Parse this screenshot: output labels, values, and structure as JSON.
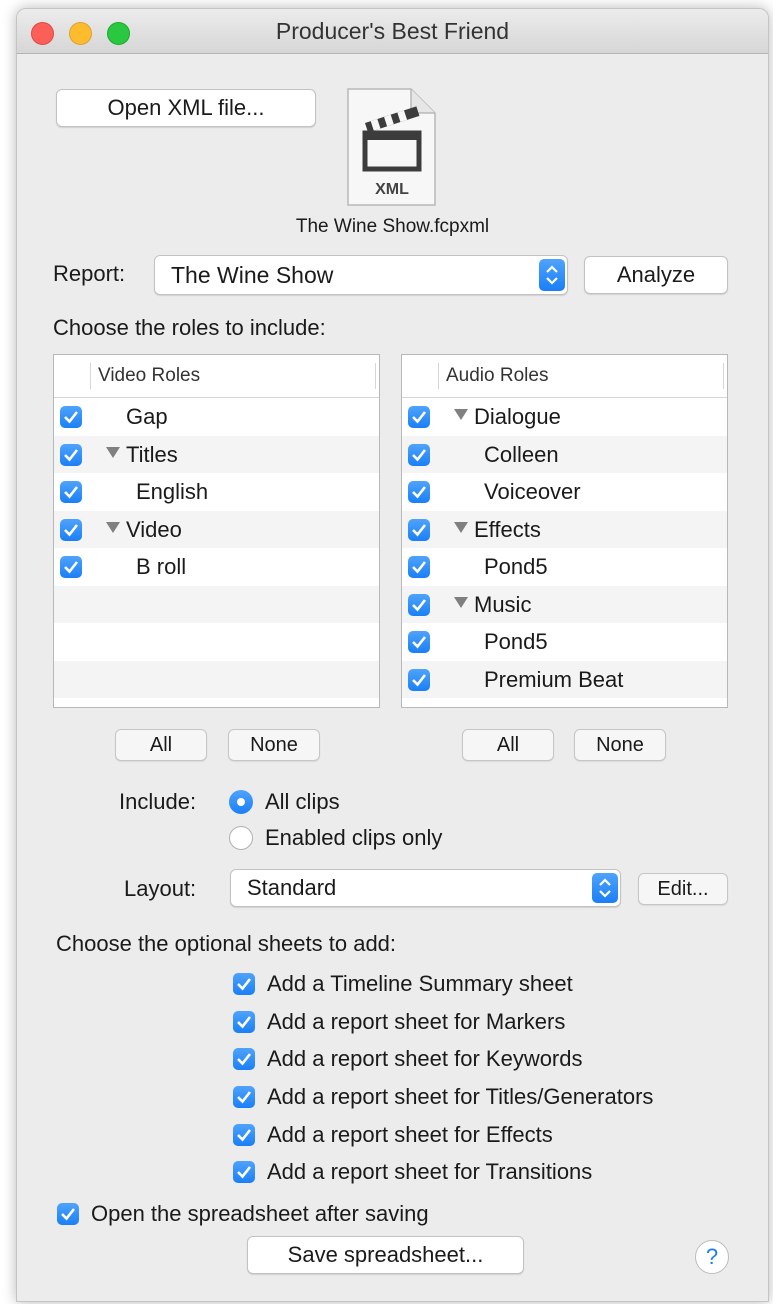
{
  "window": {
    "title": "Producer's Best Friend"
  },
  "file": {
    "open_button": "Open XML file...",
    "icon_badge": "XML",
    "filename": "The Wine Show.fcpxml"
  },
  "report": {
    "label": "Report:",
    "selected": "The Wine Show",
    "analyze_button": "Analyze"
  },
  "roles": {
    "heading": "Choose the roles to include:",
    "video": {
      "header": "Video Roles",
      "items": [
        {
          "label": "Gap",
          "checked": true
        },
        {
          "label": "Titles",
          "checked": true
        },
        {
          "label": "English",
          "checked": true
        },
        {
          "label": "Video",
          "checked": true
        },
        {
          "label": "B roll",
          "checked": true
        }
      ],
      "all_button": "All",
      "none_button": "None"
    },
    "audio": {
      "header": "Audio Roles",
      "items": [
        {
          "label": "Dialogue",
          "checked": true
        },
        {
          "label": "Colleen",
          "checked": true
        },
        {
          "label": "Voiceover",
          "checked": true
        },
        {
          "label": "Effects",
          "checked": true
        },
        {
          "label": "Pond5",
          "checked": true
        },
        {
          "label": "Music",
          "checked": true
        },
        {
          "label": "Pond5",
          "checked": true
        },
        {
          "label": "Premium Beat",
          "checked": true
        }
      ],
      "all_button": "All",
      "none_button": "None"
    }
  },
  "include": {
    "label": "Include:",
    "options": [
      {
        "label": "All clips",
        "selected": true
      },
      {
        "label": "Enabled clips only",
        "selected": false
      }
    ]
  },
  "layout": {
    "label": "Layout:",
    "selected": "Standard",
    "edit_button": "Edit..."
  },
  "sheets": {
    "heading": "Choose the optional sheets to add:",
    "items": [
      {
        "label": "Add a Timeline Summary sheet",
        "checked": true
      },
      {
        "label": "Add a report sheet for Markers",
        "checked": true
      },
      {
        "label": "Add a report sheet for Keywords",
        "checked": true
      },
      {
        "label": "Add a report sheet for Titles/Generators",
        "checked": true
      },
      {
        "label": "Add a report sheet for Effects",
        "checked": true
      },
      {
        "label": "Add a report sheet for Transitions",
        "checked": true
      }
    ]
  },
  "open_after": {
    "label": "Open the spreadsheet after saving",
    "checked": true
  },
  "save_button": "Save spreadsheet...",
  "help_button": "?",
  "colors": {
    "accent": "#1a7ff5",
    "window_bg": "#ececec"
  }
}
